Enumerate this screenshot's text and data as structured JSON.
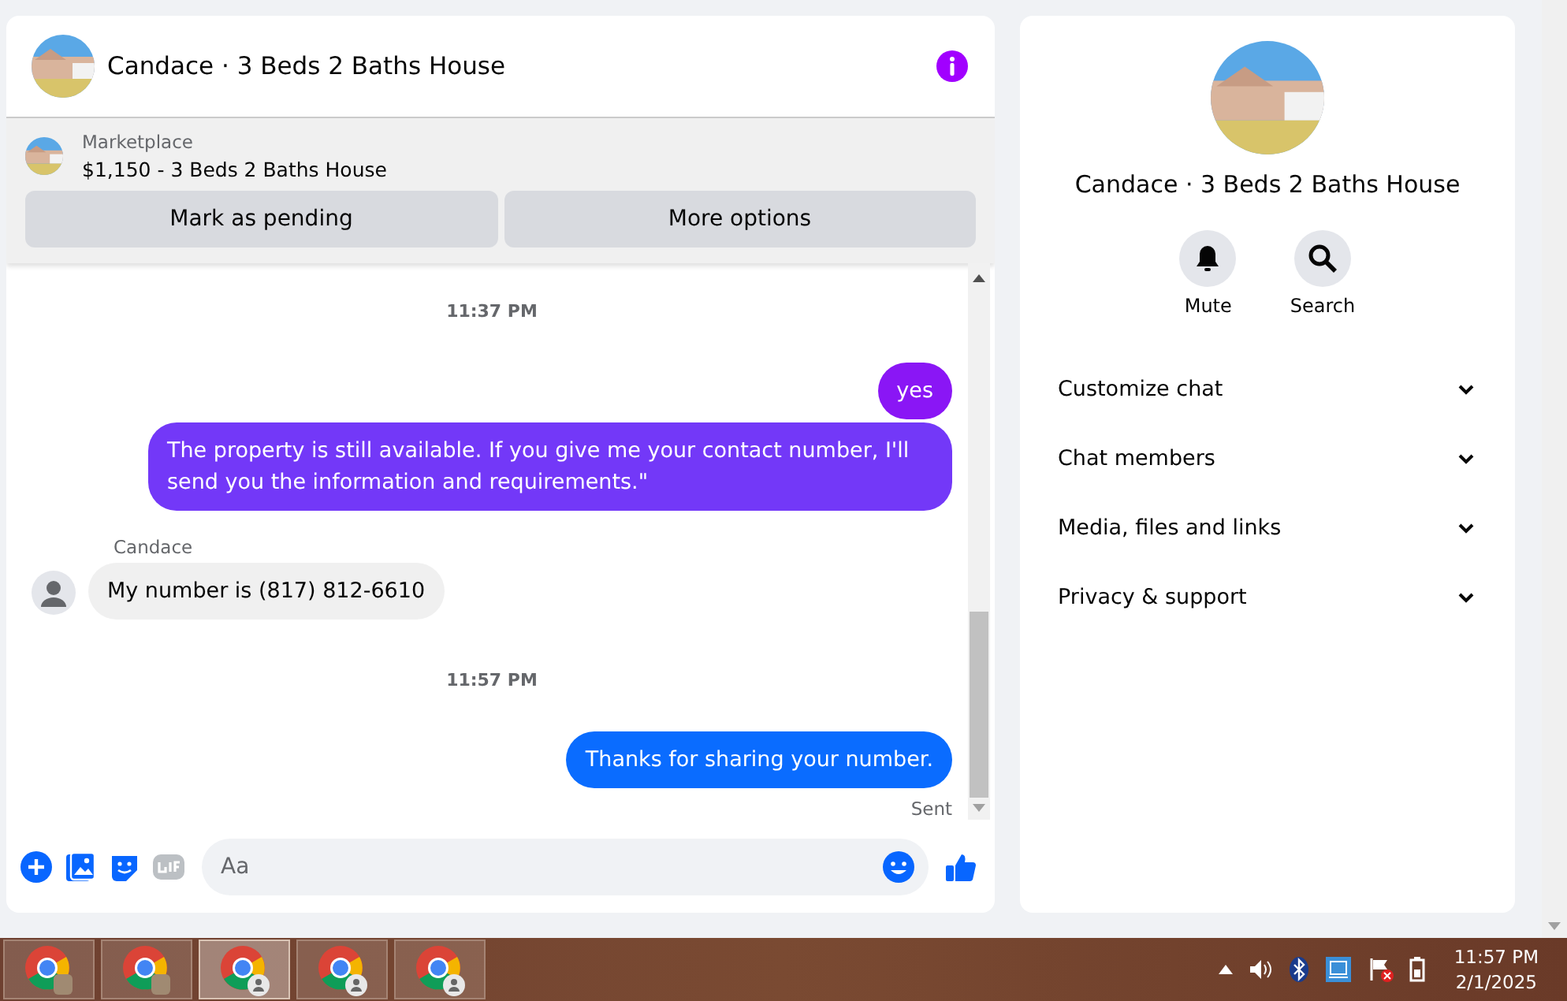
{
  "chat": {
    "title": "Candace · 3 Beds 2 Baths House",
    "listing": {
      "source": "Marketplace",
      "summary": "$1,150 - 3 Beds 2 Baths House"
    },
    "actions": [
      "Mark as pending",
      "More options"
    ],
    "messages": [
      {
        "kind": "time",
        "text": "11:37 PM"
      },
      {
        "kind": "out",
        "text": "yes",
        "color": "#8a16f5"
      },
      {
        "kind": "out",
        "text": "The property is still available. If you give me your contact number, I'll send you the information and requirements.\"",
        "color": "#7338f8"
      },
      {
        "kind": "in",
        "sender": "Candace",
        "text": "My number is (817) 812-6610"
      },
      {
        "kind": "seen"
      },
      {
        "kind": "time",
        "text": "11:57 PM"
      },
      {
        "kind": "out",
        "text": "Thanks for sharing your number.",
        "color": "#0a6cff"
      },
      {
        "kind": "status",
        "text": "Sent"
      }
    ],
    "composer": {
      "placeholder": "Aa"
    }
  },
  "info": {
    "title": "Candace · 3 Beds 2 Baths House",
    "actions": [
      {
        "kind": "mute",
        "label": "Mute"
      },
      {
        "kind": "search",
        "label": "Search"
      }
    ],
    "sections": [
      {
        "label": "Customize chat",
        "expanded": false
      },
      {
        "label": "Chat members",
        "expanded": false
      },
      {
        "label": "Media, files and links",
        "expanded": false
      },
      {
        "label": "Privacy & support",
        "expanded": false
      }
    ]
  },
  "taskbar": {
    "apps": [
      {
        "kind": "photo",
        "selected": false
      },
      {
        "kind": "photo",
        "selected": false
      },
      {
        "kind": "person",
        "selected": true
      },
      {
        "kind": "person",
        "selected": false
      },
      {
        "kind": "person",
        "selected": false
      }
    ],
    "time": "11:57 PM",
    "date": "2/1/2025"
  }
}
